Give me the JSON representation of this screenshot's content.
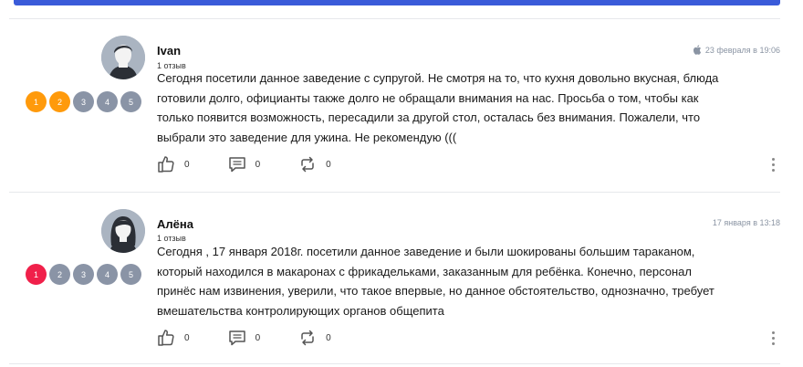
{
  "reviews": [
    {
      "author": "Ivan",
      "reviews_count": "1 отзыв",
      "date": "23 февраля в 19:06",
      "posted_from_icon": "apple-icon",
      "rating": 2,
      "rating_color": "#ff9a0b",
      "rating_labels": [
        "1",
        "2",
        "3",
        "4",
        "5"
      ],
      "text": "Сегодня посетили данное заведение с супругой. Не смотря на то, что кухня довольно вкусная, блюда готовили долго, официанты также долго не обращали внимания на нас. Просьба о том, чтобы как только появится возможность, пересадили за другой стол, осталась без внимания. Пожалели, что выбрали это заведение для ужина. Не рекомендую (((",
      "likes": "0",
      "comments": "0",
      "reposts": "0"
    },
    {
      "author": "Алёна",
      "reviews_count": "1 отзыв",
      "date": "17 января в 13:18",
      "rating": 1,
      "rating_color": "#f0204a",
      "rating_labels": [
        "1",
        "2",
        "3",
        "4",
        "5"
      ],
      "text": "Сегодня , 17 января 2018г. посетили данное заведение и были шокированы большим тараканом, который находился в макаронах с фрикадельками, заказанным для ребёнка. Конечно, персонал принёс нам извинения, уверили, что такое впервые, но данное обстоятельство, однозначно, требует вмешательства контролирующих органов общепита",
      "likes": "0",
      "comments": "0",
      "reposts": "0"
    }
  ],
  "colors": {
    "accent": "#3a5bd9",
    "inactive_rating": "#8a94a6",
    "muted_text": "#8a94a3"
  }
}
